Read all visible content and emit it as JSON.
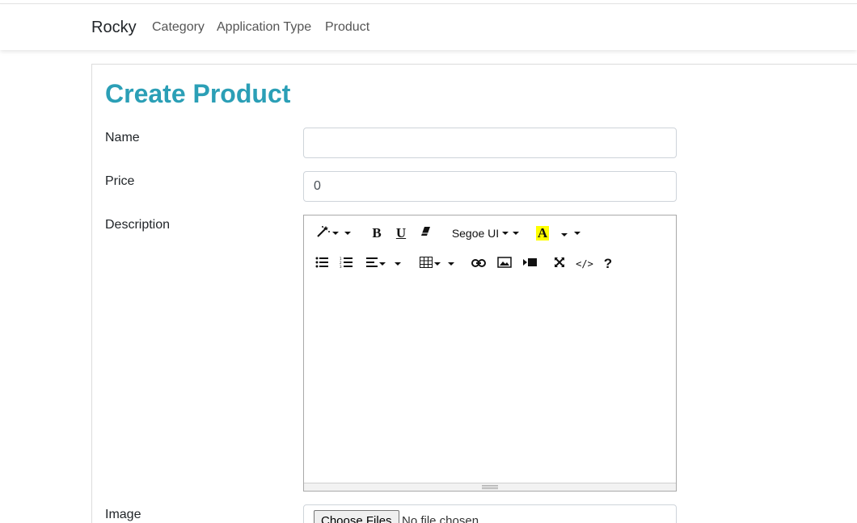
{
  "navbar": {
    "brand": "Rocky",
    "links": [
      "Category",
      "Application Type",
      "Product"
    ]
  },
  "page": {
    "title": "Create Product"
  },
  "form": {
    "name": {
      "label": "Name",
      "value": ""
    },
    "price": {
      "label": "Price",
      "value": "0"
    },
    "description": {
      "label": "Description",
      "toolbar": {
        "bold": "B",
        "underline": "U",
        "font_name": "Segoe UI",
        "color_letter": "A",
        "code_view": "</>",
        "help": "?"
      },
      "icons": [
        "magic-icon",
        "eraser-icon",
        "unordered-list-icon",
        "ordered-list-icon",
        "align-icon",
        "table-icon",
        "link-icon",
        "picture-icon",
        "video-icon",
        "fullscreen-icon"
      ],
      "highlight_color": "#ffff00"
    },
    "image": {
      "label": "Image",
      "button": "Choose Files",
      "status": "No file chosen"
    }
  },
  "colors": {
    "title": "#2b9fb6"
  }
}
